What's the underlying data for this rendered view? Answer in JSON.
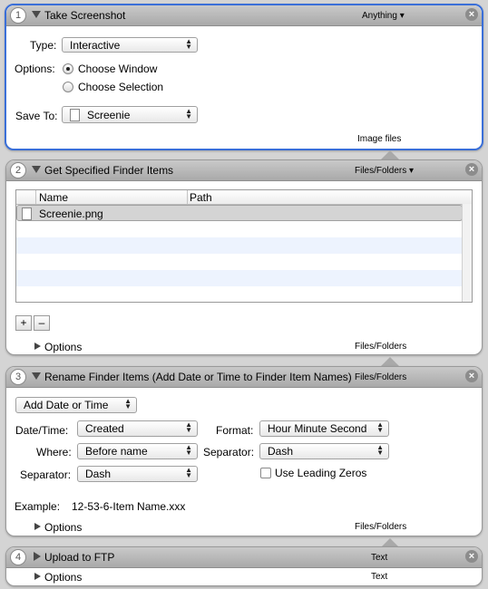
{
  "actions": [
    {
      "number": "1",
      "title": "Take Screenshot",
      "header_right": "Anything",
      "type_label": "Type:",
      "type_value": "Interactive",
      "options_label": "Options:",
      "option_window": "Choose Window",
      "option_selection": "Choose Selection",
      "save_to_label": "Save To:",
      "save_to_value": "Screenie",
      "footer_right": "Image files"
    },
    {
      "number": "2",
      "title": "Get Specified Finder Items",
      "header_right": "Files/Folders",
      "columns": [
        "Name",
        "Path"
      ],
      "rows": [
        {
          "name": "Screenie.png",
          "path": ""
        }
      ],
      "add_label": "+",
      "remove_label": "–",
      "options_label": "Options",
      "footer_right": "Files/Folders"
    },
    {
      "number": "3",
      "title": "Rename Finder Items (Add Date or Time to Finder Item Names)",
      "header_right": "Files/Folders",
      "mode_value": "Add Date or Time",
      "datetime_label": "Date/Time:",
      "datetime_value": "Created",
      "where_label": "Where:",
      "where_value": "Before name",
      "separator_label": "Separator:",
      "separator_value": "Dash",
      "format_label": "Format:",
      "format_value": "Hour Minute Second",
      "separator2_label": "Separator:",
      "separator2_value": "Dash",
      "leading_zeros_label": "Use Leading Zeros",
      "leading_zeros_checked": false,
      "example_label": "Example:",
      "example_value": "12-53-6-Item Name.xxx",
      "options_label": "Options",
      "footer_right": "Files/Folders"
    },
    {
      "number": "4",
      "title": "Upload to FTP",
      "header_right": "Text",
      "options_label": "Options",
      "footer_right": "Text"
    }
  ],
  "colors": {
    "selection_border": "#3a6fd8",
    "header_bg": "#b9b9b9",
    "alt_row": "#edf3fe"
  }
}
